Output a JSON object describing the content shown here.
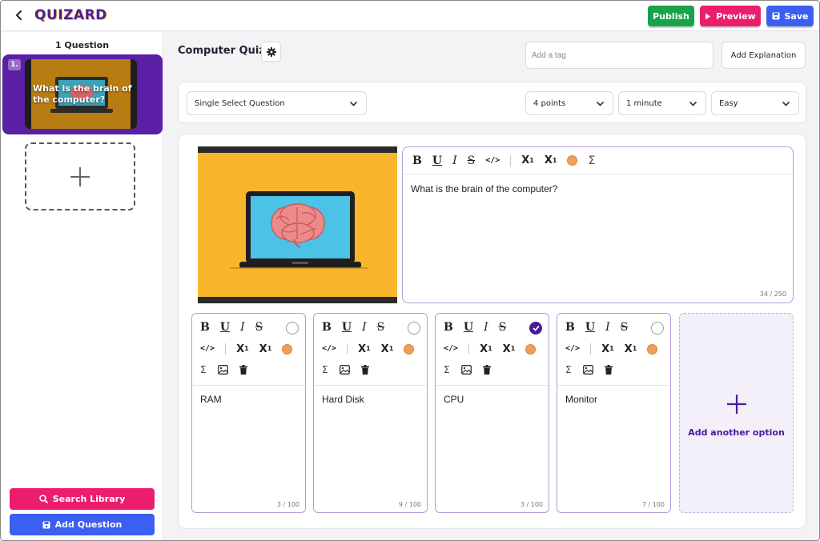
{
  "app": {
    "logo": "QUIZARD"
  },
  "header": {
    "publish_label": "Publish",
    "preview_label": "Preview",
    "save_label": "Save"
  },
  "sidebar": {
    "count_label": "1 Question",
    "questions": [
      {
        "number": "1.",
        "text": "What is the brain of the computer?"
      }
    ],
    "search_library_label": "Search Library",
    "add_question_label": "Add Question"
  },
  "quiz": {
    "title": "Computer Quiz",
    "tag_placeholder": "Add a tag",
    "add_explanation_label": "Add Explanation"
  },
  "settings": {
    "question_type": "Single Select Question",
    "points": "4 points",
    "time": "1 minute",
    "difficulty": "Easy"
  },
  "question": {
    "text": "What is the brain of the computer?",
    "char_count": "34 / 250"
  },
  "options": [
    {
      "text": "RAM",
      "char_count": "3 / 100",
      "correct": false
    },
    {
      "text": "Hard Disk",
      "char_count": "9 / 100",
      "correct": false
    },
    {
      "text": "CPU",
      "char_count": "3 / 100",
      "correct": true
    },
    {
      "text": "Monitor",
      "char_count": "7 / 100",
      "correct": false
    }
  ],
  "add_option_label": "Add another option",
  "toolbar": {
    "bold": "B",
    "underline": "U",
    "italic": "I",
    "strike": "S",
    "sub": "X",
    "sub_mark": "1",
    "sup": "X",
    "sup_mark": "1",
    "sigma": "Σ"
  },
  "colors": {
    "publish": "#16a34a",
    "preview": "#ec1d6d",
    "save": "#3b5ff0",
    "brand_purple": "#5b1fa6",
    "image_bg": "#f9b62c",
    "text_color_swatch": "#f0a055"
  }
}
